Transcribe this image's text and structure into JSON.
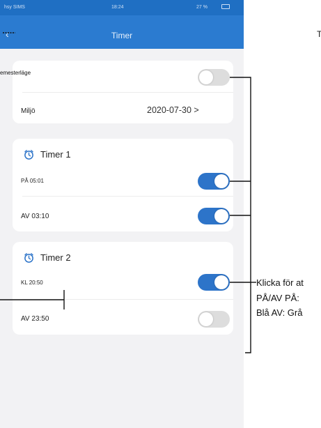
{
  "status_bar": {
    "carrier": "hsy SIMS",
    "time": "18:24",
    "battery": "27 %"
  },
  "nav": {
    "title": "Timer",
    "back_icon": "chevron-left-icon"
  },
  "settings_card": {
    "vacation_label": "emesterläge",
    "vacation_on": false,
    "environment_label": "Miljö",
    "environment_value": "2020-07-30 >"
  },
  "timer1": {
    "title": "Timer 1",
    "icon": "alarm-clock-icon",
    "rows": [
      {
        "label": "PÅ 05:01",
        "on": true
      },
      {
        "label": "AV 03:10",
        "on": true
      }
    ]
  },
  "timer2": {
    "title": "Timer 2",
    "icon": "alarm-clock-icon",
    "rows": [
      {
        "label": "KL 20:50",
        "on": true
      },
      {
        "label": "AV 23:50",
        "on": false
      }
    ]
  },
  "annotations": {
    "top_right": "T",
    "line1": "Klicka för at",
    "line2": "PÅ/AV PÅ:",
    "line3": "Blå AV: Grå"
  },
  "colors": {
    "nav": "#2b7bd0",
    "toggle_on": "#2d74c9",
    "toggle_off": "#dddddd"
  }
}
